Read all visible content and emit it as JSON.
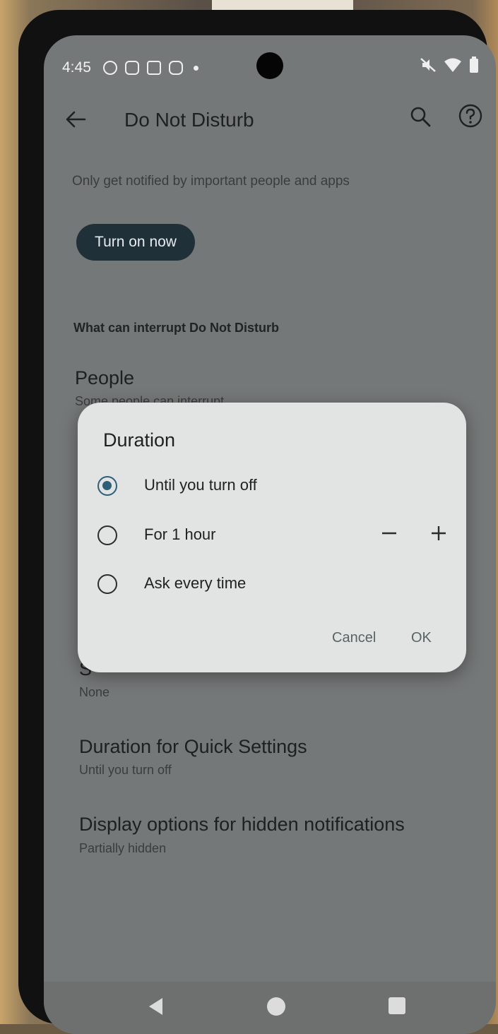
{
  "status_bar": {
    "time": "4:45",
    "notification_icons": [
      "smiley-icon",
      "close-box-icon",
      "bag-icon",
      "chat-icon"
    ],
    "right_icons": [
      "mute-icon",
      "wifi-icon",
      "battery-icon"
    ]
  },
  "app_bar": {
    "title": "Do Not Disturb",
    "back_icon": "arrow-left-icon",
    "search_icon": "search-icon",
    "help_icon": "help-icon"
  },
  "content": {
    "subtitle": "Only get notified by important people and apps",
    "turn_on_button": "Turn on now",
    "section_header": "What can interrupt Do Not Disturb",
    "people": {
      "title": "People",
      "summary": "Some people can interrupt"
    },
    "schedules": {
      "title": "S",
      "summary": "None"
    },
    "duration_qs": {
      "title": "Duration for Quick Settings",
      "summary": "Until you turn off"
    },
    "display_options": {
      "title": "Display options for hidden notifications",
      "summary": "Partially hidden"
    }
  },
  "dialog": {
    "title": "Duration",
    "options": [
      {
        "label": "Until you turn off",
        "selected": true
      },
      {
        "label": "For 1 hour",
        "selected": false
      },
      {
        "label": "Ask every time",
        "selected": false
      }
    ],
    "cancel": "Cancel",
    "ok": "OK"
  },
  "colors": {
    "accent": "#2d5f78",
    "dialog_bg": "#e2e4e4",
    "scrim_bg": "#757878",
    "button_bg": "#1f3038"
  }
}
